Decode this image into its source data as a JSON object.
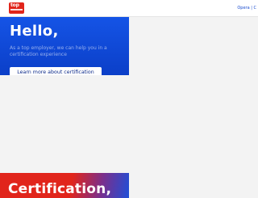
{
  "header": {
    "logo_text": "top",
    "nav_link": "Opera | C"
  },
  "hero": {
    "title": "Hello,",
    "subtitle": "As a top employer, we can help you in a certification experience",
    "cta_label": "Learn more about certification"
  },
  "section": {
    "title": "Certification,"
  },
  "colors": {
    "brand_red": "#e1251b",
    "brand_blue": "#0d47d9"
  }
}
